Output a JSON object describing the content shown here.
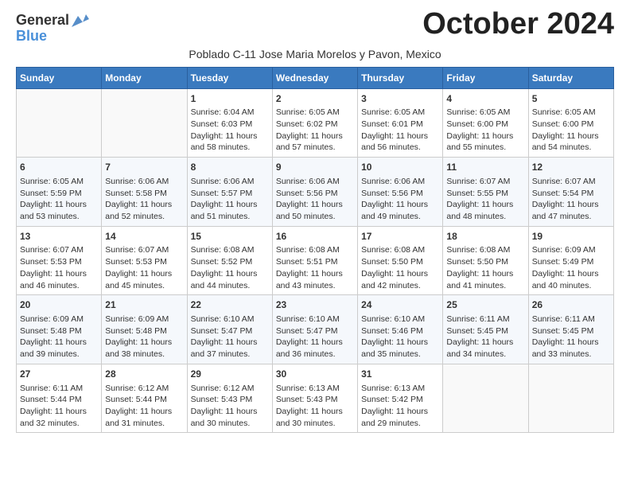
{
  "header": {
    "logo_general": "General",
    "logo_blue": "Blue",
    "month_title": "October 2024",
    "subtitle": "Poblado C-11 Jose Maria Morelos y Pavon, Mexico"
  },
  "days_of_week": [
    "Sunday",
    "Monday",
    "Tuesday",
    "Wednesday",
    "Thursday",
    "Friday",
    "Saturday"
  ],
  "weeks": [
    {
      "days": [
        {
          "day": "",
          "content": ""
        },
        {
          "day": "",
          "content": ""
        },
        {
          "day": "1",
          "content": "Sunrise: 6:04 AM\nSunset: 6:03 PM\nDaylight: 11 hours and 58 minutes."
        },
        {
          "day": "2",
          "content": "Sunrise: 6:05 AM\nSunset: 6:02 PM\nDaylight: 11 hours and 57 minutes."
        },
        {
          "day": "3",
          "content": "Sunrise: 6:05 AM\nSunset: 6:01 PM\nDaylight: 11 hours and 56 minutes."
        },
        {
          "day": "4",
          "content": "Sunrise: 6:05 AM\nSunset: 6:00 PM\nDaylight: 11 hours and 55 minutes."
        },
        {
          "day": "5",
          "content": "Sunrise: 6:05 AM\nSunset: 6:00 PM\nDaylight: 11 hours and 54 minutes."
        }
      ]
    },
    {
      "days": [
        {
          "day": "6",
          "content": "Sunrise: 6:05 AM\nSunset: 5:59 PM\nDaylight: 11 hours and 53 minutes."
        },
        {
          "day": "7",
          "content": "Sunrise: 6:06 AM\nSunset: 5:58 PM\nDaylight: 11 hours and 52 minutes."
        },
        {
          "day": "8",
          "content": "Sunrise: 6:06 AM\nSunset: 5:57 PM\nDaylight: 11 hours and 51 minutes."
        },
        {
          "day": "9",
          "content": "Sunrise: 6:06 AM\nSunset: 5:56 PM\nDaylight: 11 hours and 50 minutes."
        },
        {
          "day": "10",
          "content": "Sunrise: 6:06 AM\nSunset: 5:56 PM\nDaylight: 11 hours and 49 minutes."
        },
        {
          "day": "11",
          "content": "Sunrise: 6:07 AM\nSunset: 5:55 PM\nDaylight: 11 hours and 48 minutes."
        },
        {
          "day": "12",
          "content": "Sunrise: 6:07 AM\nSunset: 5:54 PM\nDaylight: 11 hours and 47 minutes."
        }
      ]
    },
    {
      "days": [
        {
          "day": "13",
          "content": "Sunrise: 6:07 AM\nSunset: 5:53 PM\nDaylight: 11 hours and 46 minutes."
        },
        {
          "day": "14",
          "content": "Sunrise: 6:07 AM\nSunset: 5:53 PM\nDaylight: 11 hours and 45 minutes."
        },
        {
          "day": "15",
          "content": "Sunrise: 6:08 AM\nSunset: 5:52 PM\nDaylight: 11 hours and 44 minutes."
        },
        {
          "day": "16",
          "content": "Sunrise: 6:08 AM\nSunset: 5:51 PM\nDaylight: 11 hours and 43 minutes."
        },
        {
          "day": "17",
          "content": "Sunrise: 6:08 AM\nSunset: 5:50 PM\nDaylight: 11 hours and 42 minutes."
        },
        {
          "day": "18",
          "content": "Sunrise: 6:08 AM\nSunset: 5:50 PM\nDaylight: 11 hours and 41 minutes."
        },
        {
          "day": "19",
          "content": "Sunrise: 6:09 AM\nSunset: 5:49 PM\nDaylight: 11 hours and 40 minutes."
        }
      ]
    },
    {
      "days": [
        {
          "day": "20",
          "content": "Sunrise: 6:09 AM\nSunset: 5:48 PM\nDaylight: 11 hours and 39 minutes."
        },
        {
          "day": "21",
          "content": "Sunrise: 6:09 AM\nSunset: 5:48 PM\nDaylight: 11 hours and 38 minutes."
        },
        {
          "day": "22",
          "content": "Sunrise: 6:10 AM\nSunset: 5:47 PM\nDaylight: 11 hours and 37 minutes."
        },
        {
          "day": "23",
          "content": "Sunrise: 6:10 AM\nSunset: 5:47 PM\nDaylight: 11 hours and 36 minutes."
        },
        {
          "day": "24",
          "content": "Sunrise: 6:10 AM\nSunset: 5:46 PM\nDaylight: 11 hours and 35 minutes."
        },
        {
          "day": "25",
          "content": "Sunrise: 6:11 AM\nSunset: 5:45 PM\nDaylight: 11 hours and 34 minutes."
        },
        {
          "day": "26",
          "content": "Sunrise: 6:11 AM\nSunset: 5:45 PM\nDaylight: 11 hours and 33 minutes."
        }
      ]
    },
    {
      "days": [
        {
          "day": "27",
          "content": "Sunrise: 6:11 AM\nSunset: 5:44 PM\nDaylight: 11 hours and 32 minutes."
        },
        {
          "day": "28",
          "content": "Sunrise: 6:12 AM\nSunset: 5:44 PM\nDaylight: 11 hours and 31 minutes."
        },
        {
          "day": "29",
          "content": "Sunrise: 6:12 AM\nSunset: 5:43 PM\nDaylight: 11 hours and 30 minutes."
        },
        {
          "day": "30",
          "content": "Sunrise: 6:13 AM\nSunset: 5:43 PM\nDaylight: 11 hours and 30 minutes."
        },
        {
          "day": "31",
          "content": "Sunrise: 6:13 AM\nSunset: 5:42 PM\nDaylight: 11 hours and 29 minutes."
        },
        {
          "day": "",
          "content": ""
        },
        {
          "day": "",
          "content": ""
        }
      ]
    }
  ]
}
